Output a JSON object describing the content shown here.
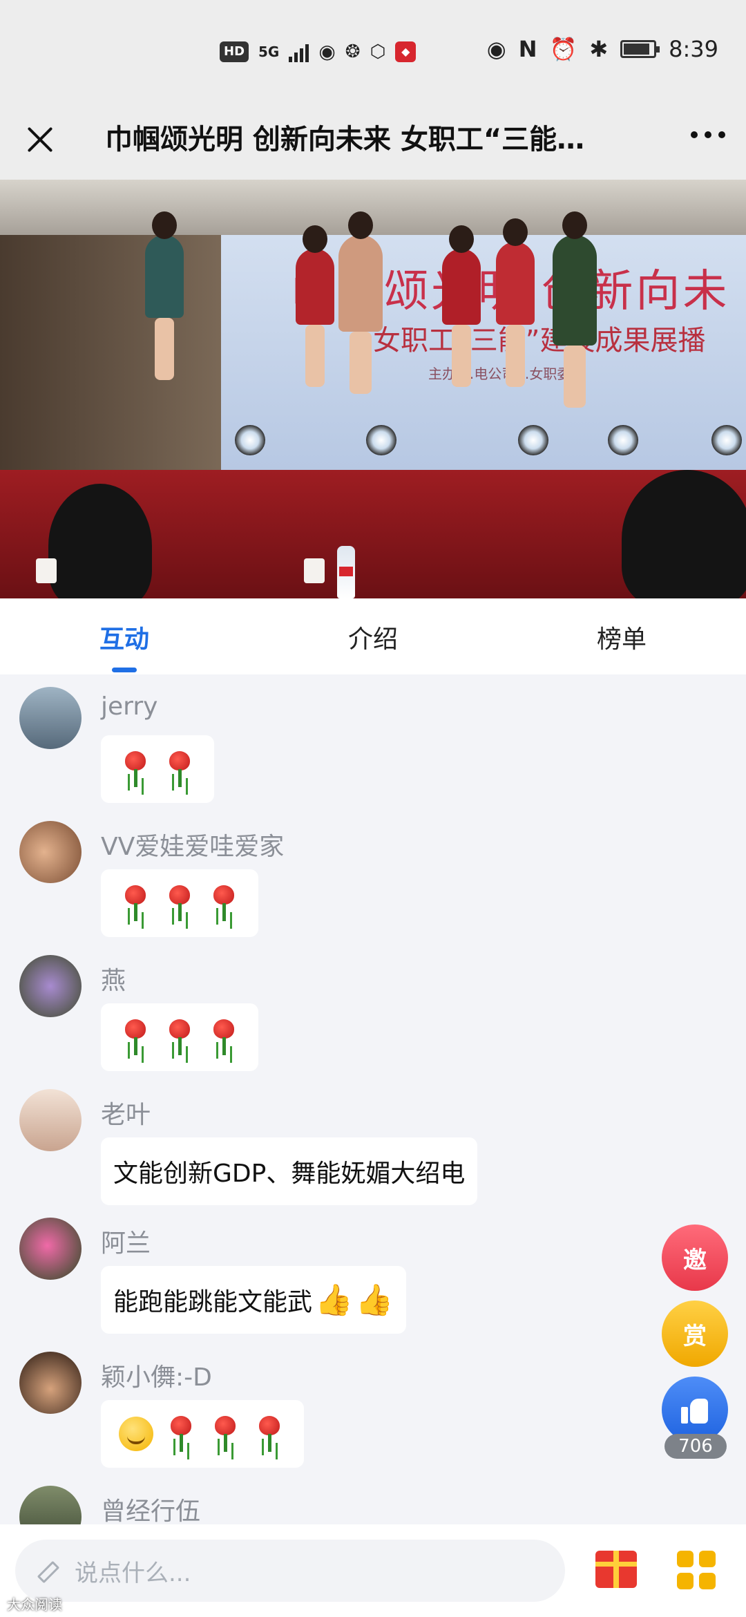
{
  "status_bar": {
    "left_badges": [
      "HD",
      "5G"
    ],
    "time": "8:39",
    "right_icons": [
      "eye-icon",
      "nfc-icon",
      "alarm-icon",
      "bluetooth-icon",
      "battery-icon"
    ]
  },
  "header": {
    "title": "巾帼颂光明 创新向未来 女职工“三能…"
  },
  "video": {
    "banner_line1": "巾帼颂光明 创新向未",
    "banner_line2": "女职工“三能”建设成果展播",
    "banner_line3": "主办 …电公司…女职委"
  },
  "tabs": [
    {
      "label": "互动",
      "active": true
    },
    {
      "label": "介绍",
      "active": false
    },
    {
      "label": "榜单",
      "active": false
    }
  ],
  "comments": [
    {
      "name": "jerry",
      "text": "",
      "roses": 2,
      "emoji": false
    },
    {
      "name": "VV爱娃爱哇爱家",
      "text": "",
      "roses": 3,
      "emoji": false
    },
    {
      "name": "燕",
      "text": "",
      "roses": 3,
      "emoji": false
    },
    {
      "name": "老叶",
      "text": "文能创新GDP、舞能妩媚大绍电",
      "roses": 0,
      "emoji": false
    },
    {
      "name": "阿兰",
      "text": "能跑能跳能文能武",
      "roses": 0,
      "emoji": false
    },
    {
      "name": "颖小儛:-D",
      "text": "",
      "roses": 3,
      "emoji": true
    },
    {
      "name": "曾经行伍",
      "text": "",
      "roses": 0,
      "emoji": false
    }
  ],
  "side_buttons": {
    "invite_label": "邀",
    "reward_label": "赏",
    "like_count": "706"
  },
  "input": {
    "placeholder": "说点什么..."
  },
  "watermark": "大众阅读",
  "colors": {
    "accent": "#1f6fe5",
    "invite": "#e8384a",
    "reward": "#f0a800",
    "like": "#1f63e0"
  }
}
